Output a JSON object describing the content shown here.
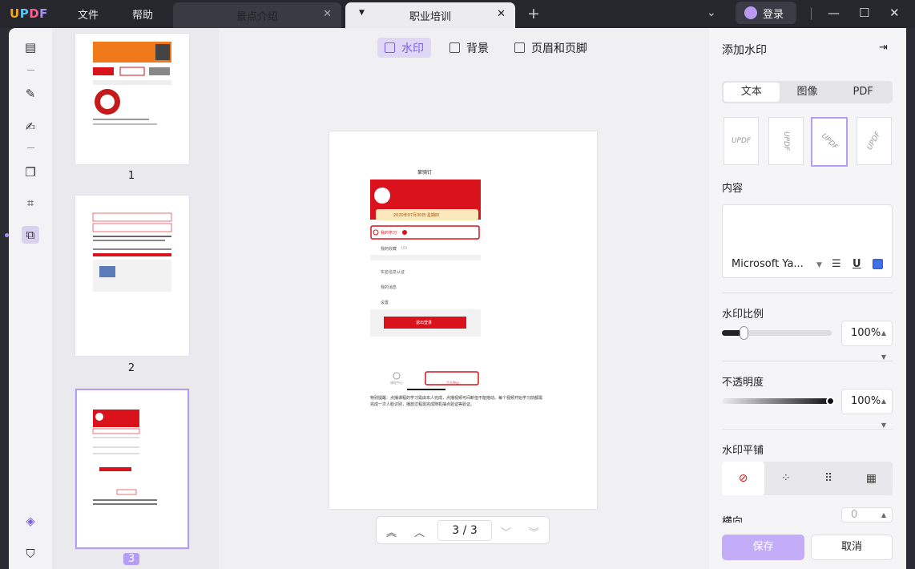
{
  "app": {
    "logo": "UPDF",
    "menus": [
      "文件",
      "帮助"
    ],
    "tabs": [
      {
        "label": "景点介绍",
        "active": false
      },
      {
        "label": "职业培训",
        "active": true
      }
    ],
    "login": "登录"
  },
  "thumbnails": {
    "pages": [
      "1",
      "2",
      "3"
    ],
    "selected": "3"
  },
  "modes": [
    {
      "label": "水印",
      "active": true
    },
    {
      "label": "背景",
      "active": false
    },
    {
      "label": "页眉和页脚",
      "active": false
    }
  ],
  "document": {
    "title": "掌骑钉",
    "date_line": "2020年07月30日 星期四",
    "rows": [
      "我的学习",
      "我的收藏",
      "实名信息认证",
      "我的消息",
      "设置"
    ],
    "favorites_count": "(0)",
    "logout": "退出登录",
    "bottom_tabs": [
      "课程中心",
      "个人中心"
    ],
    "note": "特别提醒：点播课程的学习需由本人完成，点播视频可间断但不能拖动。每个视频开始学习前都需完成一次人脸识别，播放过程需完成随机抽点验证等验证。"
  },
  "pager": {
    "current": "3",
    "total": "3",
    "sep": "/"
  },
  "panel": {
    "title": "添加水印",
    "type_tabs": [
      "文本",
      "图像",
      "PDF"
    ],
    "style_preview": "UPDF",
    "content_label": "内容",
    "font": "Microsoft Ya...",
    "scale_label": "水印比例",
    "scale_value": "100%",
    "scale_fraction": 0.2,
    "opacity_label": "不透明度",
    "opacity_value": "100%",
    "opacity_fraction": 1.0,
    "tile_label": "水印平铺",
    "horizontal_label": "横向",
    "horizontal_value": "0",
    "save": "保存",
    "cancel": "取消"
  },
  "colors": {
    "accent": "#b39df5",
    "doc_red": "#d9121b"
  }
}
